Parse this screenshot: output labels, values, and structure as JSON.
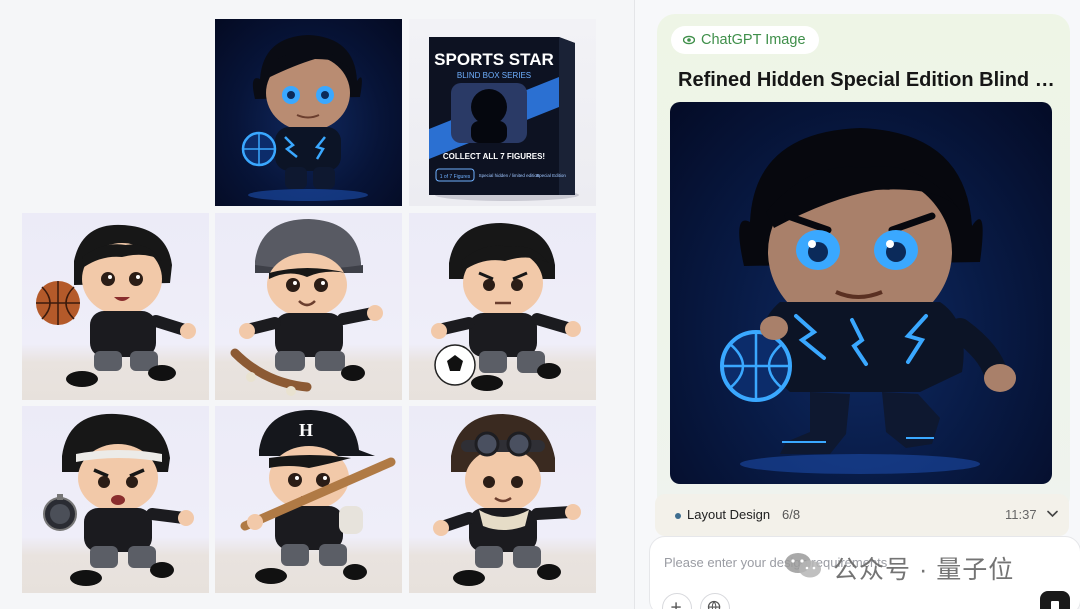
{
  "gallery": {
    "tiles": [
      {
        "label": "glowing-figure",
        "style": "dark"
      },
      {
        "label": "blind-box-package",
        "style": "box"
      },
      {
        "label": "basketball-figure",
        "style": "light"
      },
      {
        "label": "skateboard-figure",
        "style": "light"
      },
      {
        "label": "soccer-figure",
        "style": "light"
      },
      {
        "label": "stopwatch-figure",
        "style": "light"
      },
      {
        "label": "baseball-figure",
        "style": "light"
      },
      {
        "label": "goggles-figure",
        "style": "light"
      }
    ],
    "box": {
      "title": "SPORTS STAR",
      "subtitle": "BLIND BOX SERIES",
      "collect": "COLLECT ALL 7 FIGURES!",
      "tag_left": "1 of 7 Figures",
      "tag_mid": "Special hidden / limited edition",
      "tag_right": "Special Edition"
    },
    "cap_letter": "H"
  },
  "panel": {
    "chip_label": "ChatGPT Image",
    "title": "Refined Hidden Special Edition Blind Box Figure",
    "layout_label": "Layout Design",
    "layout_count": "6/8",
    "layout_time": "11:37",
    "input_placeholder": "Please enter your design requirements",
    "watermark": "公众号 · 量子位"
  },
  "colors": {
    "accent_green": "#3f8f4a",
    "glow_blue": "#3aa8ff",
    "dark_bg": "#071438"
  }
}
